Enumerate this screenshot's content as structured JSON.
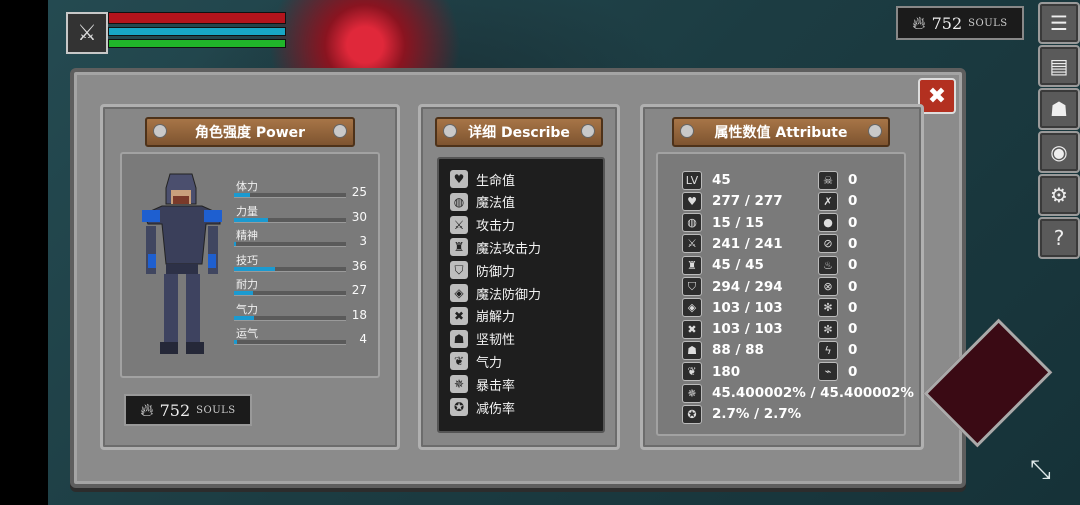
{
  "hud": {
    "icon": "crossed-swords-icon",
    "health_level": 1.0,
    "mana_level": 1.0,
    "stamina_level": 1.0,
    "souls": "752",
    "souls_label": "SOULS"
  },
  "side_buttons": [
    "menu-icon",
    "backpack-icon",
    "helmet-icon",
    "shield-icon",
    "gear-icon",
    "help-icon"
  ],
  "panels": {
    "power": {
      "title": "角色强度 Power",
      "stats": [
        {
          "label": "体力",
          "value": "25",
          "level": 0.14
        },
        {
          "label": "力量",
          "value": "30",
          "level": 0.3
        },
        {
          "label": "精神",
          "value": "3",
          "level": 0.02
        },
        {
          "label": "技巧",
          "value": "36",
          "level": 0.37
        },
        {
          "label": "耐力",
          "value": "27",
          "level": 0.17
        },
        {
          "label": "气力",
          "value": "18",
          "level": 0.18
        },
        {
          "label": "运气",
          "value": "4",
          "level": 0.03
        }
      ],
      "souls": "752",
      "souls_label": "SOULS"
    },
    "describe": {
      "title": "详细 Describe",
      "items": [
        {
          "label": "生命值",
          "icon": "heart-icon"
        },
        {
          "label": "魔法值",
          "icon": "potion-icon"
        },
        {
          "label": "攻击力",
          "icon": "sword-icon"
        },
        {
          "label": "魔法攻击力",
          "icon": "castle-icon"
        },
        {
          "label": "防御力",
          "icon": "shield-icon"
        },
        {
          "label": "魔法防御力",
          "icon": "magic-shield-icon"
        },
        {
          "label": "崩解力",
          "icon": "break-icon"
        },
        {
          "label": "坚韧性",
          "icon": "helmet-icon"
        },
        {
          "label": "气力",
          "icon": "lungs-icon"
        },
        {
          "label": "暴击率",
          "icon": "star-burst-icon"
        },
        {
          "label": "减伤率",
          "icon": "badge-icon"
        }
      ]
    },
    "attribute": {
      "title": "属性数值 Attribute",
      "left": [
        {
          "icon": "lv-icon",
          "glyph": "LV",
          "value": "45"
        },
        {
          "icon": "heart-icon",
          "glyph": "♥",
          "value": "277 / 277"
        },
        {
          "icon": "potion-icon",
          "glyph": "◍",
          "value": "15 / 15"
        },
        {
          "icon": "sword-icon",
          "glyph": "⚔",
          "value": "241 / 241"
        },
        {
          "icon": "castle-icon",
          "glyph": "♜",
          "value": "45 / 45"
        },
        {
          "icon": "shield-icon",
          "glyph": "⛉",
          "value": "294 / 294"
        },
        {
          "icon": "magic-shield-icon",
          "glyph": "◈",
          "value": "103 / 103"
        },
        {
          "icon": "break-icon",
          "glyph": "✖",
          "value": "103 / 103"
        },
        {
          "icon": "helmet-icon",
          "glyph": "☗",
          "value": "88 / 88"
        },
        {
          "icon": "lungs-icon",
          "glyph": "❦",
          "value": "180"
        },
        {
          "icon": "star-burst-icon",
          "glyph": "✵",
          "value": "45.400002% / 45.400002%"
        },
        {
          "icon": "badge-icon",
          "glyph": "✪",
          "value": "2.7% / 2.7%"
        }
      ],
      "right": [
        {
          "icon": "skull-icon",
          "glyph": "☠",
          "value": "0"
        },
        {
          "icon": "crossbones-icon",
          "glyph": "✗",
          "value": "0"
        },
        {
          "icon": "water-drop-icon",
          "glyph": "●",
          "value": "0"
        },
        {
          "icon": "no-bleed-icon",
          "glyph": "⊘",
          "value": "0"
        },
        {
          "icon": "fire-icon",
          "glyph": "♨",
          "value": "0"
        },
        {
          "icon": "no-fire-icon",
          "glyph": "⊗",
          "value": "0"
        },
        {
          "icon": "frost-icon",
          "glyph": "✻",
          "value": "0"
        },
        {
          "icon": "no-frost-icon",
          "glyph": "✼",
          "value": "0"
        },
        {
          "icon": "lightning-icon",
          "glyph": "ϟ",
          "value": "0"
        },
        {
          "icon": "no-lightning-icon",
          "glyph": "⌁",
          "value": "0"
        }
      ]
    }
  }
}
